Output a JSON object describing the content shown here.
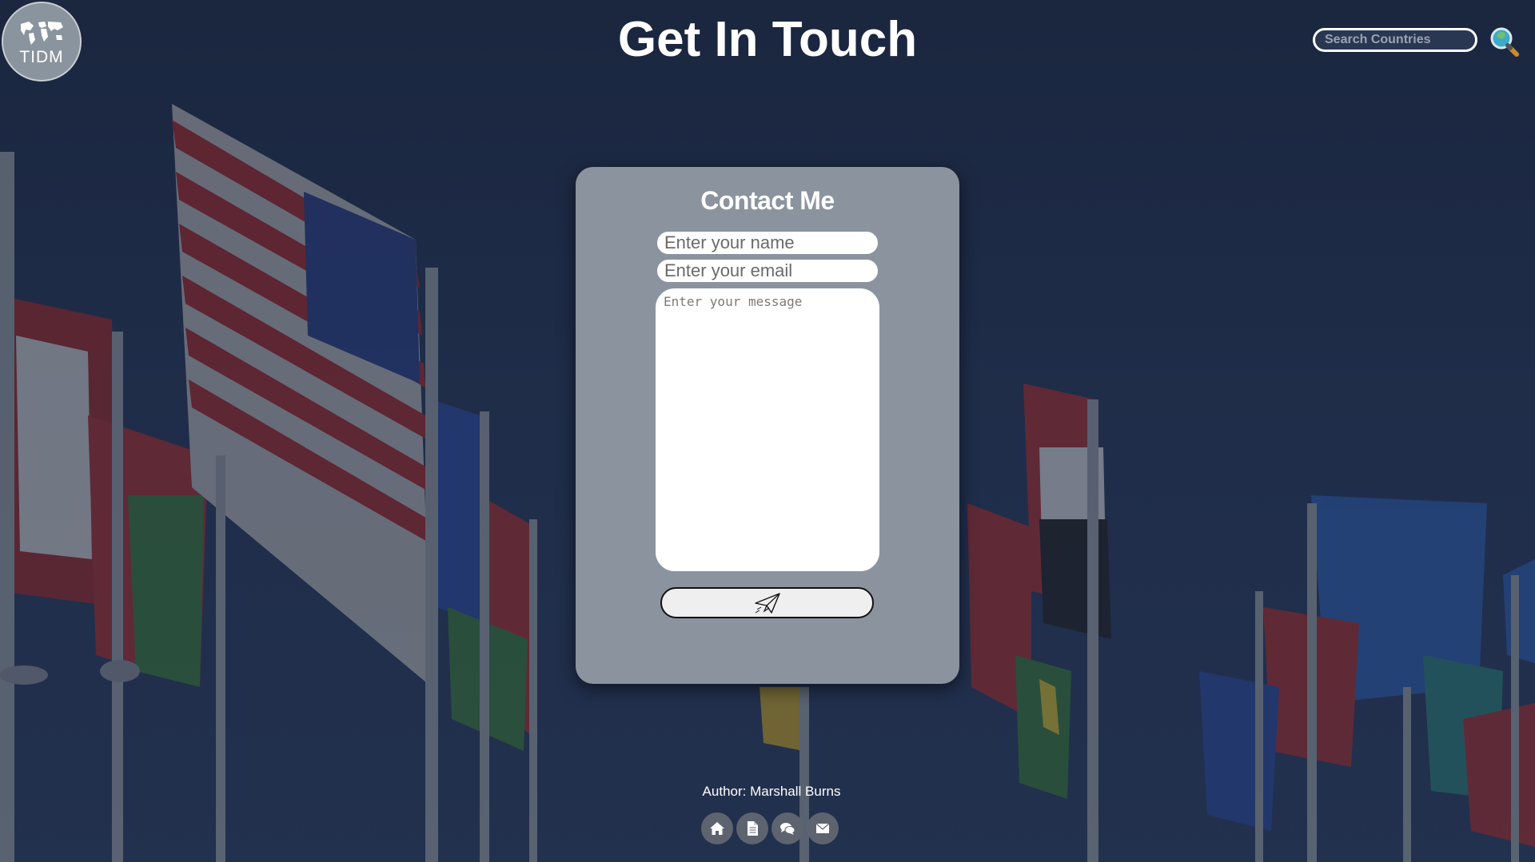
{
  "header": {
    "logo_text": "TIDM",
    "title": "Get In Touch",
    "search_placeholder": "Search Countries"
  },
  "contact": {
    "title": "Contact Me",
    "name_placeholder": "Enter your name",
    "email_placeholder": "Enter your email",
    "message_placeholder": "Enter your message",
    "name_value": "",
    "email_value": "",
    "message_value": ""
  },
  "footer": {
    "author": "Author: Marshall Burns",
    "nav_icons": [
      "home-icon",
      "document-icon",
      "chat-icon",
      "mail-icon"
    ]
  },
  "colors": {
    "card": "#8b949e",
    "background": "#253657",
    "footer_button": "#5d6470"
  }
}
